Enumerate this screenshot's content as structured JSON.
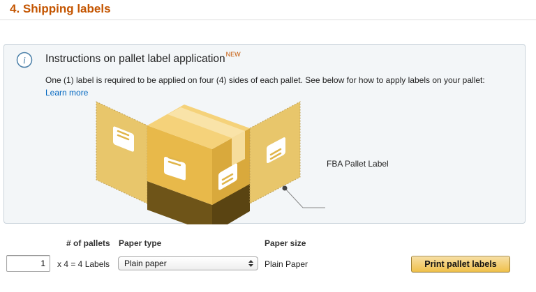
{
  "section": {
    "title": "4. Shipping labels"
  },
  "instructions": {
    "title": "Instructions on pallet label application",
    "badge": "NEW",
    "description": "One (1) label is required to be applied on four (4) sides of each pallet. See below for how to apply labels on your pallet:",
    "learn_more": "Learn more",
    "callout": "FBA Pallet Label",
    "icon": "info-icon"
  },
  "form": {
    "headers": {
      "pallets": "# of pallets",
      "paper_type": "Paper type",
      "paper_size": "Paper size"
    },
    "pallets_value": "1",
    "calculation": "x 4 = 4 Labels",
    "paper_type_selected": "Plain paper",
    "paper_size_value": "Plain Paper",
    "print_button": "Print pallet labels"
  },
  "colors": {
    "title": "#c45500",
    "link": "#0066c0",
    "box_background": "#f3f6f8",
    "box_border": "#c9d3db",
    "box_main": "#e8b94a",
    "box_dark": "#6e5418",
    "button": "#f0c14b"
  }
}
